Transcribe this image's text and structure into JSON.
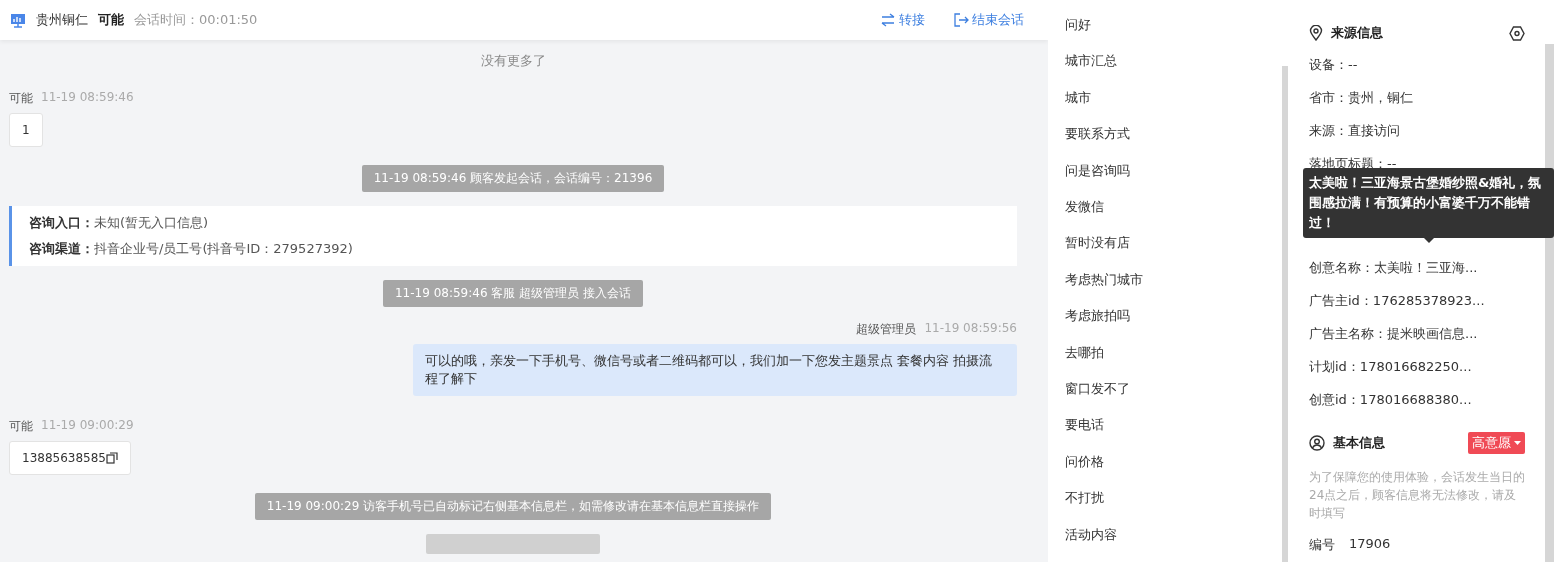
{
  "header": {
    "location": "贵州铜仁",
    "visitor_name": "可能",
    "session_time": "会话时间：00:01:50",
    "actions": [
      {
        "kind": "transfer",
        "label": "转接"
      },
      {
        "kind": "end",
        "label": "结束会话"
      }
    ]
  },
  "chat": {
    "no_more": "没有更多了",
    "messages": [
      {
        "kind": "visitor",
        "sender": "可能",
        "time": "11-19 08:59:46",
        "text": "1",
        "copyable": false
      },
      {
        "kind": "system",
        "text": "11-19 08:59:46 顾客发起会话，会话编号：21396"
      },
      {
        "kind": "info",
        "lines": [
          {
            "label": "咨询入口：",
            "value": "未知(暂无入口信息)"
          },
          {
            "label": "咨询渠道：",
            "value": "抖音企业号/员工号(抖音号ID：279527392)"
          }
        ]
      },
      {
        "kind": "system",
        "text": "11-19 08:59:46 客服 超级管理员 接入会话"
      },
      {
        "kind": "agent",
        "sender": "超级管理员",
        "time": "11-19 08:59:56",
        "text": "可以的哦，亲发一下手机号、微信号或者二维码都可以，我们加一下您发主题景点 套餐内容 拍摄流程了解下"
      },
      {
        "kind": "visitor",
        "sender": "可能",
        "time": "11-19 09:00:29",
        "text": "13885638585",
        "copyable": true
      },
      {
        "kind": "system",
        "text": "11-19 09:00:29 访客手机号已自动标记右侧基本信息栏，如需修改请在基本信息栏直接操作"
      },
      {
        "kind": "bar"
      }
    ]
  },
  "quick_replies": [
    "问好",
    "城市汇总",
    "城市",
    "要联系方式",
    "问是咨询吗",
    "发微信",
    "暂时没有店",
    "考虑热门城市",
    "考虑旅拍吗",
    "去哪拍",
    "窗口发不了",
    "要电话",
    "问价格",
    "不打扰",
    "活动内容"
  ],
  "source_info": {
    "title": "来源信息",
    "rows": [
      "设备：--",
      "省市：贵州，铜仁",
      "来源：直接访问",
      "落地页标题：--"
    ],
    "rows_below_tooltip": [
      "创意名称：太美啦！三亚海...",
      "广告主id：176285378923...",
      "广告主名称：提米映画信息...",
      "计划id：178016682250...",
      "创意id：178016688380..."
    ],
    "tooltip": "太美啦！三亚海景古堡婚纱照&婚礼，氛围感拉满！有预算的小富婆千万不能错过！"
  },
  "basic_info": {
    "title": "基本信息",
    "tag": "高意愿",
    "note": "为了保障您的使用体验，会话发生当日的24点之后，顾客信息将无法修改，请及时填写",
    "fields": [
      {
        "label": "编号",
        "value": "17906"
      }
    ]
  }
}
